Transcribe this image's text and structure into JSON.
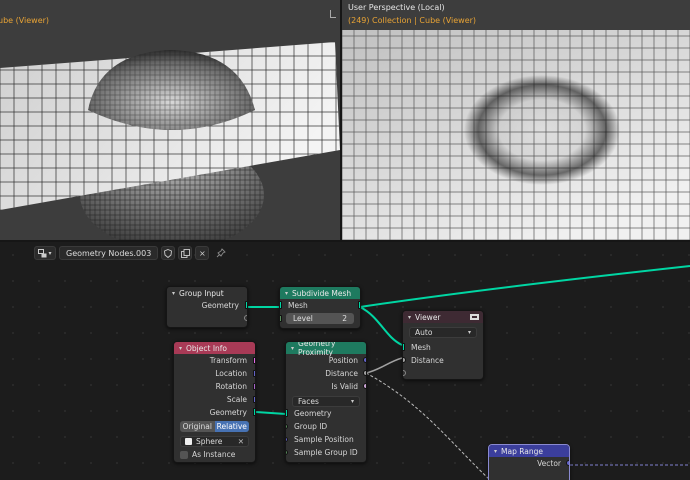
{
  "viewports": {
    "left": {
      "title": "",
      "subtitle": "ube (Viewer)"
    },
    "right": {
      "title": "User Perspective (Local)",
      "subtitle": "(249) Collection | Cube (Viewer)"
    }
  },
  "editor_header": {
    "tree_name": "Geometry Nodes.003",
    "shield_icon": "shield-icon",
    "copy_icon": "duplicate-icon",
    "close_icon": "×",
    "pin_icon": "pin-icon"
  },
  "nodes": {
    "group_input": {
      "title": "Group Input",
      "outputs": [
        "Geometry"
      ]
    },
    "subdivide": {
      "title": "Subdivide Mesh",
      "input_mesh": "Mesh",
      "level_label": "Level",
      "level_value": "2"
    },
    "viewer": {
      "title": "Viewer",
      "domain": "Auto",
      "inputs": [
        "Mesh",
        "Distance"
      ]
    },
    "object_info": {
      "title": "Object Info",
      "outputs": [
        "Transform",
        "Location",
        "Rotation",
        "Scale",
        "Geometry"
      ],
      "mode_original": "Original",
      "mode_relative": "Relative",
      "object": "Sphere",
      "as_instance": "As Instance"
    },
    "proximity": {
      "title": "Geometry Proximity",
      "outputs": [
        "Position",
        "Distance",
        "Is Valid"
      ],
      "target": "Faces",
      "inputs": [
        "Geometry",
        "Group ID",
        "Sample Position",
        "Sample Group ID"
      ]
    },
    "map_range": {
      "title": "Map Range",
      "output": "Vector"
    }
  },
  "colors": {
    "geometry_socket": "#00d6a3",
    "vector_socket": "#6363c7",
    "float_socket": "#a1a1a1",
    "int_socket": "#598c5c",
    "object_header": "#a83a56",
    "geometry_header": "#1e7a5f",
    "viewer_header": "#3e2a33",
    "vector_header": "#3b3e9c",
    "accent_orange": "#e8a335",
    "toggle_active": "#4772b3"
  }
}
